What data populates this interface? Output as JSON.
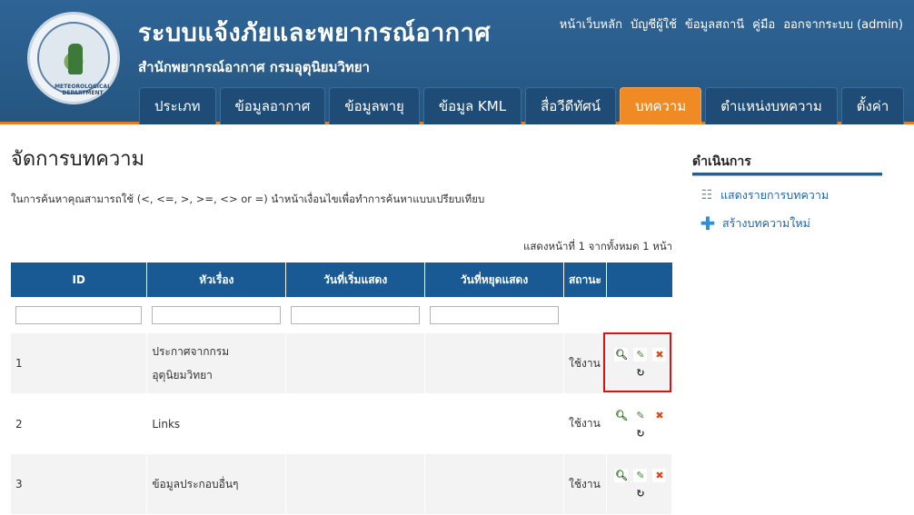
{
  "header": {
    "title": "ระบบแจ้งภัยและพยากรณ์อากาศ",
    "subtitle": "สำนักพยากรณ์อากาศ กรมอุตุนิยมวิทยา",
    "logo_text": "METEOROLOGICAL DEPARTMENT",
    "toplinks": [
      "หน้าเว็บหลัก",
      "บัญชีผู้ใช้",
      "ข้อมูลสถานี",
      "คู่มือ",
      "ออกจากระบบ (admin)"
    ]
  },
  "nav": {
    "tabs": [
      "ประเภท",
      "ข้อมูลอากาศ",
      "ข้อมูลพายุ",
      "ข้อมูล KML",
      "สื่อวีดีทัศน์",
      "บทความ",
      "ตำแหน่งบทความ",
      "ตั้งค่า"
    ],
    "active": "บทความ"
  },
  "main": {
    "page_title": "จัดการบทความ",
    "hint": "ในการค้นหาคุณสามารถใช้ (<, <=, >, >=, <> or =) นำหน้าเงื่อนไขเพื่อทำการค้นหาแบบเปรียบเทียบ",
    "pageinfo": "แสดงหน้าที่ 1 จากทั้งหมด 1 หน้า"
  },
  "table": {
    "columns": [
      "ID",
      "หัวเรื่อง",
      "วันที่เริ่มแสดง",
      "วันที่หยุดแสดง",
      "สถานะ",
      ""
    ],
    "rows": [
      {
        "id": "1",
        "title_line1": "ประกาศจากกรม",
        "title_line2": "อุตุนิยมวิทยา",
        "start": "",
        "end": "",
        "status": "ใช้งาน"
      },
      {
        "id": "2",
        "title_line1": "Links",
        "title_line2": "",
        "start": "",
        "end": "",
        "status": "ใช้งาน"
      },
      {
        "id": "3",
        "title_line1": "ข้อมูลประกอบอื่นๆ",
        "title_line2": "",
        "start": "",
        "end": "",
        "status": "ใช้งาน"
      }
    ],
    "action_icons": [
      "magnifier-icon",
      "pencil-icon",
      "delete-icon",
      "reset-icon"
    ]
  },
  "sidebar": {
    "title": "ดำเนินการ",
    "items": [
      "แสดงรายการบทความ",
      "สร้างบทความใหม่"
    ]
  },
  "colors": {
    "header_bg": "#2a5d8e",
    "active_tab": "#f08a24",
    "table_header": "#1a5a94",
    "link": "#1e64b0",
    "highlight": "#e01010"
  }
}
